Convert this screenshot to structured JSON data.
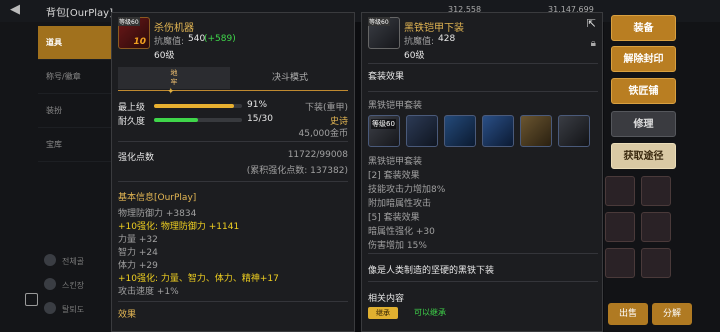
{
  "background": {
    "title": "背包[OurPlay]",
    "stat1": "312,558",
    "stat2": "31,147,699",
    "left_tabs": [
      "道具",
      "称号/徽章",
      "装扮",
      "宝库"
    ],
    "left_items": [
      "전체골",
      "스킨장",
      "탈퇴도"
    ],
    "bottom_buttons": [
      "出售",
      "分解"
    ]
  },
  "left_panel": {
    "item_name": "杀伤机器",
    "icon_level": "等级60",
    "icon_plus": "10",
    "power_label": "抗魔值:",
    "power_value": "540",
    "power_bonus": "(+589)",
    "level_text": "60级",
    "tabs": [
      "地\n牢",
      "决斗模式"
    ],
    "max_level_label": "最上级",
    "max_level_pct": "91%",
    "max_level_value": 91,
    "durability_label": "耐久度",
    "durability_value": "15/30",
    "durability_fraction": 0.5,
    "slot_text": "下装(重甲)",
    "grade_text": "史诗",
    "price_text": "45,000金币",
    "enhance_label": "强化点数",
    "enhance_value": "11722/99008",
    "enhance_sub": "(累积强化点数: 137382)",
    "basic_info_title": "基本信息[OurPlay]",
    "stats": [
      {
        "text": "物理防御力 +3834",
        "cls": "grey"
      },
      {
        "text": "+10强化: 物理防御力 +1141",
        "cls": "yellow"
      },
      {
        "text": "力量 +32",
        "cls": "grey"
      },
      {
        "text": "智力 +24",
        "cls": "grey"
      },
      {
        "text": "体力 +29",
        "cls": "grey"
      },
      {
        "text": "+10强化: 力量、智力、体力、精神+17",
        "cls": "yellow"
      },
      {
        "text": "攻击速度 +1%",
        "cls": "grey"
      }
    ],
    "effect_title": "效果"
  },
  "right_panel": {
    "item_name": "黑铁铠甲下装",
    "icon_level": "等级60",
    "power_label": "抗魔值:",
    "power_value": "428",
    "level_text": "60级",
    "set_effect_title": "套装效果",
    "set_name": "黑铁铠甲套装",
    "set_icon_labels": [
      "等级60",
      "",
      "",
      "",
      "",
      ""
    ],
    "set_name_2": "黑铁铠甲套装",
    "set_lines": [
      "[2] 套装效果",
      "技能攻击力增加8%",
      "附加暗属性攻击",
      "[5] 套装效果",
      "暗属性强化 +30",
      "伤害增加 15%"
    ],
    "description": "像是人类制造的坚硬的黑铁下装",
    "related_title": "相关内容",
    "related_badge": "继承",
    "related_text": "可以继承"
  },
  "actions": {
    "equip": "装备",
    "unseal": "解除封印",
    "smith": "铁匠铺",
    "repair": "修理",
    "obtain": "获取途径"
  },
  "colors": {
    "accent": "#b97e22",
    "epic": "#e3b653",
    "bonus": "#3fd64a",
    "enhance": "#f0d020"
  }
}
